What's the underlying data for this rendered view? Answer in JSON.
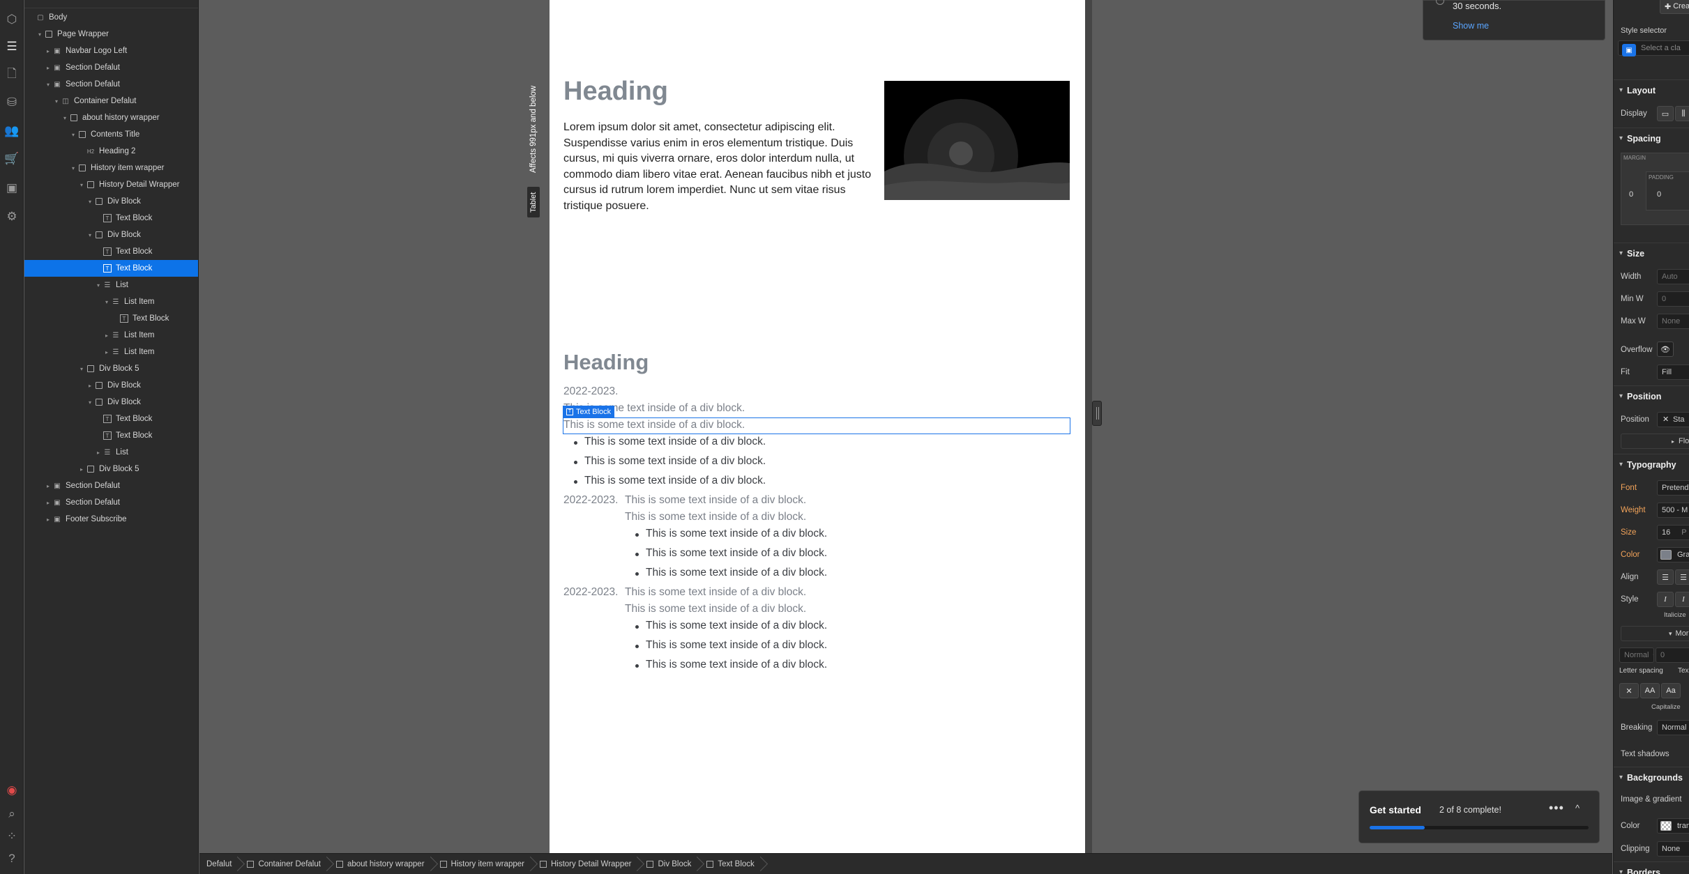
{
  "navigator": {
    "items": [
      {
        "label": "Body",
        "depth": 0,
        "caret": "",
        "icon": "body"
      },
      {
        "label": "Page Wrapper",
        "depth": 1,
        "caret": "down",
        "icon": "box"
      },
      {
        "label": "Navbar Logo Left",
        "depth": 2,
        "caret": "right",
        "icon": "component"
      },
      {
        "label": "Section Defalut",
        "depth": 2,
        "caret": "right",
        "icon": "component"
      },
      {
        "label": "Section Defalut",
        "depth": 2,
        "caret": "down",
        "icon": "component"
      },
      {
        "label": "Container Defalut",
        "depth": 3,
        "caret": "down",
        "icon": "container"
      },
      {
        "label": "about history wrapper",
        "depth": 4,
        "caret": "down",
        "icon": "box"
      },
      {
        "label": "Contents Title",
        "depth": 5,
        "caret": "down",
        "icon": "box"
      },
      {
        "label": "Heading 2",
        "depth": 6,
        "caret": "",
        "icon": "H2"
      },
      {
        "label": "History item wrapper",
        "depth": 5,
        "caret": "down",
        "icon": "box"
      },
      {
        "label": "History Detail Wrapper",
        "depth": 6,
        "caret": "down",
        "icon": "box"
      },
      {
        "label": "Div Block",
        "depth": 7,
        "caret": "down",
        "icon": "box"
      },
      {
        "label": "Text Block",
        "depth": 8,
        "caret": "",
        "icon": "T"
      },
      {
        "label": "Div Block",
        "depth": 7,
        "caret": "down",
        "icon": "box"
      },
      {
        "label": "Text Block",
        "depth": 8,
        "caret": "",
        "icon": "T"
      },
      {
        "label": "Text Block",
        "depth": 8,
        "caret": "",
        "icon": "T",
        "selected": true
      },
      {
        "label": "List",
        "depth": 8,
        "caret": "down",
        "icon": "list"
      },
      {
        "label": "List Item",
        "depth": 9,
        "caret": "down",
        "icon": "list"
      },
      {
        "label": "Text Block",
        "depth": 10,
        "caret": "",
        "icon": "T"
      },
      {
        "label": "List Item",
        "depth": 9,
        "caret": "right",
        "icon": "list"
      },
      {
        "label": "List Item",
        "depth": 9,
        "caret": "right",
        "icon": "list"
      },
      {
        "label": "Div Block 5",
        "depth": 6,
        "caret": "down",
        "icon": "box"
      },
      {
        "label": "Div Block",
        "depth": 7,
        "caret": "right",
        "icon": "box"
      },
      {
        "label": "Div Block",
        "depth": 7,
        "caret": "down",
        "icon": "box"
      },
      {
        "label": "Text Block",
        "depth": 8,
        "caret": "",
        "icon": "T"
      },
      {
        "label": "Text Block",
        "depth": 8,
        "caret": "",
        "icon": "T"
      },
      {
        "label": "List",
        "depth": 8,
        "caret": "right",
        "icon": "list"
      },
      {
        "label": "Div Block 5",
        "depth": 6,
        "caret": "right",
        "icon": "box"
      },
      {
        "label": "Section Defalut",
        "depth": 2,
        "caret": "right",
        "icon": "component"
      },
      {
        "label": "Section Defalut",
        "depth": 2,
        "caret": "right",
        "icon": "component"
      },
      {
        "label": "Footer Subscribe",
        "depth": 2,
        "caret": "right",
        "icon": "component"
      }
    ]
  },
  "canvas": {
    "breakpoint_tag": "Tablet",
    "breakpoint_note": "Affects 991px and below",
    "hero": {
      "heading": "Heading",
      "paragraph": "Lorem ipsum dolor sit amet, consectetur adipiscing elit. Suspendisse varius enim in eros elementum tristique. Duis cursus, mi quis viverra ornare, eros dolor interdum nulla, ut commodo diam libero vitae erat. Aenean faucibus nibh et justo cursus id rutrum lorem imperdiet. Nunc ut sem vitae risus tristique posuere."
    },
    "history": {
      "heading": "Heading",
      "selected_badge": "Text Block",
      "block1": {
        "year": "2022-2023.",
        "line1": "This is some text inside of a div block.",
        "line2": "This is some text inside of a div block.",
        "bullets": [
          "This is some text inside of a div block.",
          "This is some text inside of a div block.",
          "This is some text inside of a div block."
        ]
      },
      "block2": {
        "year": "2022-2023.",
        "line1": "This is some text inside of a div block.",
        "line2": "This is some text inside of a div block.",
        "bullets": [
          "This is some text inside of a div block.",
          "This is some text inside of a div block.",
          "This is some text inside of a div block."
        ]
      },
      "block3": {
        "year": "2022-2023.",
        "line1": "This is some text inside of a div block.",
        "line2": "This is some text inside of a div block.",
        "bullets": [
          "This is some text inside of a div block.",
          "This is some text inside of a div block.",
          "This is some text inside of a div block."
        ]
      }
    }
  },
  "toast": {
    "message": "30 seconds.",
    "link": "Show me"
  },
  "get_started": {
    "title": "Get started",
    "progress_text": "2 of 8 complete!",
    "progress_fraction": 0.25,
    "more": "•••",
    "collapse": "^"
  },
  "breadcrumbs": [
    "Defalut",
    "Container Defalut",
    "about history wrapper",
    "History item wrapper",
    "History Detail Wrapper",
    "Div Block",
    "Text Block"
  ],
  "style_panel": {
    "create_btn": "Creat",
    "style_selector_label": "Style selector",
    "style_selector_placeholder": "Select a cla",
    "layout": {
      "title": "Layout",
      "display_label": "Display"
    },
    "spacing": {
      "title": "Spacing",
      "margin_label": "MARGIN",
      "padding_label": "PADDING",
      "margin_value": "0",
      "padding_value": "0"
    },
    "size": {
      "title": "Size",
      "width_label": "Width",
      "width_value": "Auto",
      "minw_label": "Min W",
      "minw_value": "0",
      "maxw_label": "Max W",
      "maxw_value": "None",
      "overflow_label": "Overflow",
      "fit_label": "Fit",
      "fit_value": "Fill"
    },
    "position": {
      "title": "Position",
      "position_label": "Position",
      "position_value": "Sta",
      "float_label": "Floa"
    },
    "typography": {
      "title": "Typography",
      "font_label": "Font",
      "font_value": "Pretend",
      "weight_label": "Weight",
      "weight_value": "500 - M",
      "size_label": "Size",
      "size_value": "16",
      "size_unit": "P",
      "color_label": "Color",
      "color_value": "Gra",
      "align_label": "Align",
      "style_label": "Style",
      "italicize": "Italicize",
      "more": "More",
      "normal": "Normal",
      "spacing_zero": "0",
      "letter_spacing": "Letter spacing",
      "text_label": "Tex",
      "aa1": "AA",
      "aa2": "Aa",
      "capitalize": "Capitalize",
      "breaking_label": "Breaking",
      "breaking_value": "Normal",
      "text_shadows": "Text shadows"
    },
    "backgrounds": {
      "title": "Backgrounds",
      "image_gradient": "Image & gradient",
      "color_label": "Color",
      "color_value": "tran",
      "clipping_label": "Clipping",
      "clipping_value": "None"
    },
    "borders": {
      "title": "Borders"
    }
  },
  "colors": {
    "accent": "#1a73e8",
    "panel_bg": "#2b2b2b",
    "canvas_bg": "#5c5c5c",
    "heading_gray": "#808891",
    "text_gray": "#7b8089"
  }
}
